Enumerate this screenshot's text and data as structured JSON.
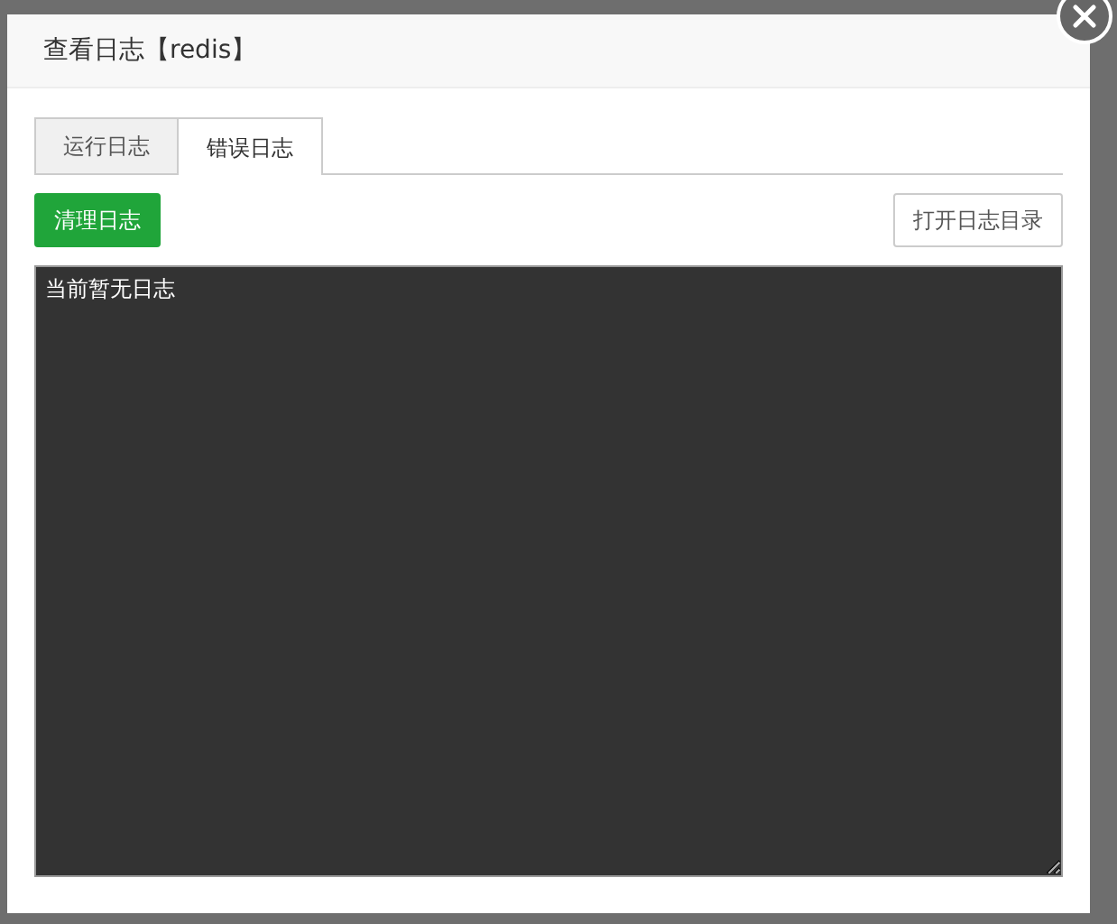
{
  "dialog": {
    "title": "查看日志【redis】"
  },
  "tabs": [
    {
      "label": "运行日志",
      "selected": false
    },
    {
      "label": "错误日志",
      "selected": true
    }
  ],
  "buttons": [
    {
      "label": "清理日志",
      "kind": "primary"
    },
    {
      "label": "打开日志目录",
      "kind": "outline"
    }
  ],
  "log": {
    "value": "当前暂无日志"
  }
}
